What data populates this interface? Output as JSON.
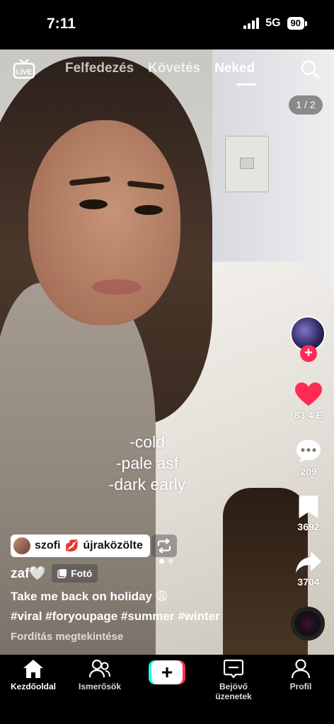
{
  "status_bar": {
    "time": "7:11",
    "network": "5G",
    "battery": "90"
  },
  "top_nav": {
    "live_label": "LIVE",
    "tabs": [
      {
        "label": "Felfedezés"
      },
      {
        "label": "Követés"
      },
      {
        "label": "Neked"
      }
    ],
    "active_tab": "Neked"
  },
  "photo_counter": "1 / 2",
  "overlay_text": [
    "-cold",
    "-pale asf",
    "-dark early"
  ],
  "carousel": {
    "total": 2,
    "active": 1
  },
  "actions": {
    "likes": "83,4 E",
    "comments": "209",
    "saves": "3692",
    "shares": "3704"
  },
  "repost": {
    "user": "szofi",
    "user_emoji": "💋",
    "text": "újraközölte"
  },
  "author": {
    "name": "zaf🤍",
    "badge": "Fotó"
  },
  "description": "Take me back on holiday 😩",
  "hashtags": "#viral #foryoupage #summer #winter",
  "translate_label": "Fordítás megtekintése",
  "tabbar": {
    "home": "Kezdőoldal",
    "friends": "Ismerősök",
    "create": "+",
    "inbox": "Bejövő üzenetek",
    "profile": "Profil"
  },
  "colors": {
    "accent_red": "#fe2c55",
    "accent_cyan": "#25f4ee",
    "like_heart": "#fe2c55"
  },
  "icons": [
    "live-icon",
    "search-icon",
    "heart-icon",
    "comment-icon",
    "bookmark-icon",
    "share-icon",
    "repost-icon",
    "photo-icon",
    "home-icon",
    "friends-icon",
    "inbox-icon",
    "profile-icon"
  ]
}
